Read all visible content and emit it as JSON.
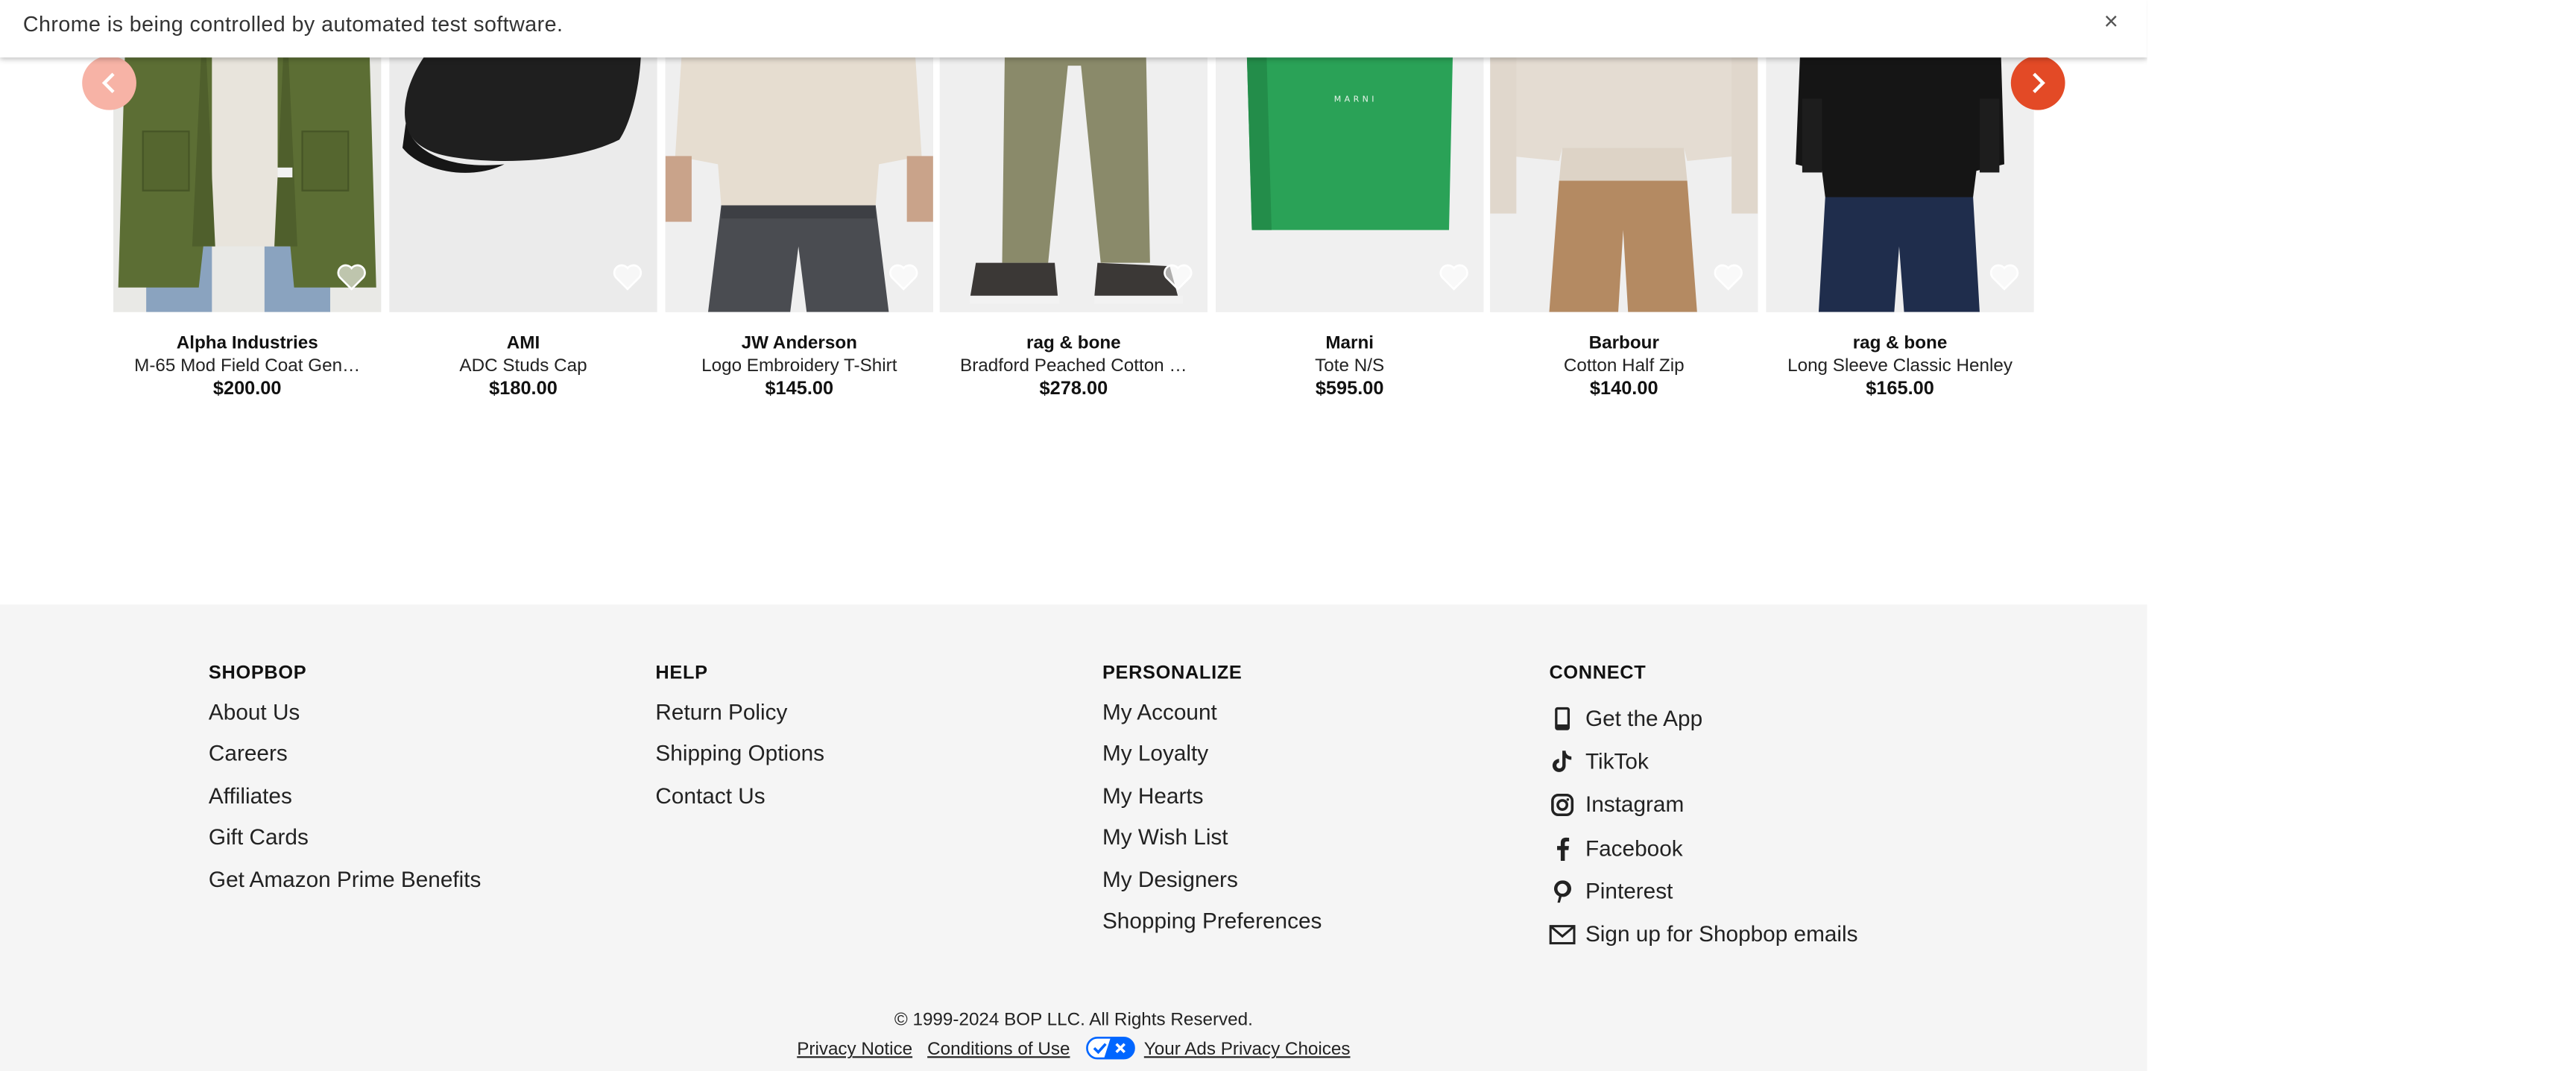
{
  "infobar": {
    "message": "Chrome is being controlled by automated test software.",
    "close_label": "×"
  },
  "carousel": {
    "products": [
      {
        "brand": "Alpha Industries",
        "name": "M-65 Mod Field Coat Gen…",
        "price": "$200.00"
      },
      {
        "brand": "AMI",
        "name": "ADC Studs Cap",
        "price": "$180.00"
      },
      {
        "brand": "JW Anderson",
        "name": "Logo Embroidery T-Shirt",
        "price": "$145.00"
      },
      {
        "brand": "rag & bone",
        "name": "Bradford Peached Cotton …",
        "price": "$278.00"
      },
      {
        "brand": "Marni",
        "name": "Tote N/S",
        "price": "$595.00"
      },
      {
        "brand": "Barbour",
        "name": "Cotton Half Zip",
        "price": "$140.00"
      },
      {
        "brand": "rag & bone",
        "name": "Long Sleeve Classic Henley",
        "price": "$165.00"
      }
    ]
  },
  "footer": {
    "shopbop": {
      "heading": "SHOPBOP",
      "links": [
        "About Us",
        "Careers",
        "Affiliates",
        "Gift Cards",
        "Get Amazon Prime Benefits"
      ]
    },
    "help": {
      "heading": "HELP",
      "links": [
        "Return Policy",
        "Shipping Options",
        "Contact Us"
      ]
    },
    "personalize": {
      "heading": "PERSONALIZE",
      "links": [
        "My Account",
        "My Loyalty",
        "My Hearts",
        "My Wish List",
        "My Designers",
        "Shopping Preferences"
      ]
    },
    "connect": {
      "heading": "CONNECT",
      "links": [
        {
          "label": "Get the App",
          "icon": "phone-icon"
        },
        {
          "label": "TikTok",
          "icon": "tiktok-icon"
        },
        {
          "label": "Instagram",
          "icon": "instagram-icon"
        },
        {
          "label": "Facebook",
          "icon": "facebook-icon"
        },
        {
          "label": "Pinterest",
          "icon": "pinterest-icon"
        },
        {
          "label": "Sign up for Shopbop emails",
          "icon": "mail-icon"
        }
      ]
    },
    "copyright": "© 1999-2024 BOP LLC. All Rights Reserved.",
    "legal": {
      "privacy": "Privacy Notice",
      "conditions": "Conditions of Use",
      "ads": "Your Ads Privacy Choices"
    }
  },
  "colors": {
    "accent": "#e34a26",
    "accent_light": "#f7b3a6",
    "footer_bg": "#f5f5f5",
    "ccpa_blue": "#0066ff"
  }
}
